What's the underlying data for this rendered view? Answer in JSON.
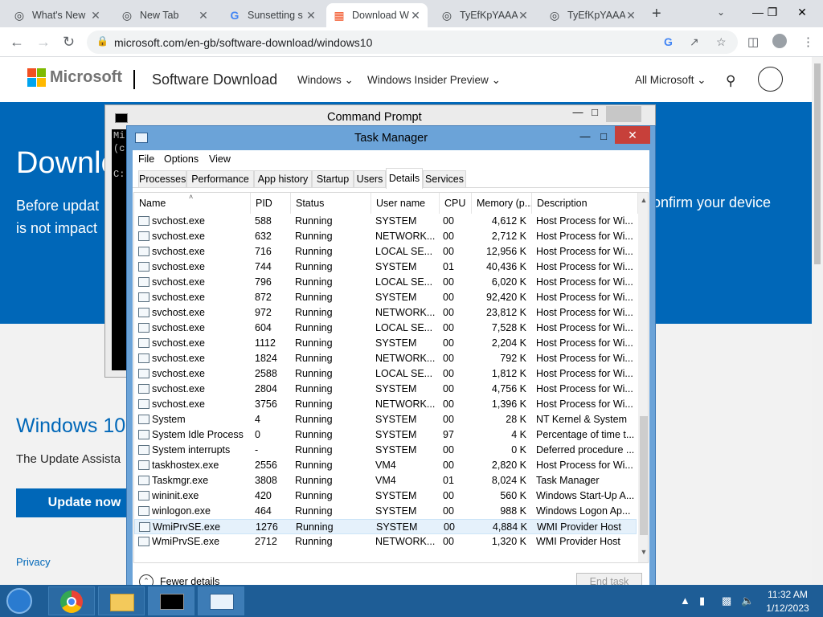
{
  "browser": {
    "tabs": [
      {
        "label": "What's New",
        "icon": "chrome-icon",
        "active": false
      },
      {
        "label": "New Tab",
        "icon": "chrome-icon",
        "active": false
      },
      {
        "label": "Sunsetting s",
        "icon": "google-icon",
        "active": false
      },
      {
        "label": "Download W",
        "icon": "microsoft-icon",
        "active": true
      },
      {
        "label": "TyEfKpYAAA",
        "icon": "chrome-icon",
        "active": false
      },
      {
        "label": "TyEfKpYAAA",
        "icon": "chrome-icon",
        "active": false
      }
    ],
    "url": "microsoft.com/en-gb/software-download/windows10"
  },
  "mspage": {
    "brand": "Microsoft",
    "title": "Software Download",
    "nav": [
      "Windows",
      "Windows Insider Preview"
    ],
    "all_microsoft": "All Microsoft",
    "hero_title": "Downlo",
    "hero_text_1": "Before updat",
    "hero_text_2": "is not impact",
    "hero_right": "onfirm your device",
    "win10_heading": "Windows 10",
    "update_text": "The Update Assista",
    "update_button": "Update now",
    "privacy": "Privacy"
  },
  "cmd": {
    "title": "Command Prompt",
    "lines": [
      "Mi",
      "(c",
      "",
      "C:"
    ]
  },
  "taskmgr": {
    "title": "Task Manager",
    "menu": [
      "File",
      "Options",
      "View"
    ],
    "tabs": [
      "Processes",
      "Performance",
      "App history",
      "Startup",
      "Users",
      "Details",
      "Services"
    ],
    "active_tab": "Details",
    "columns": [
      "Name",
      "PID",
      "Status",
      "User name",
      "CPU",
      "Memory (p...",
      "Description"
    ],
    "rows": [
      {
        "name": "svchost.exe",
        "pid": "588",
        "status": "Running",
        "user": "SYSTEM",
        "cpu": "00",
        "mem": "4,612 K",
        "desc": "Host Process for Wi..."
      },
      {
        "name": "svchost.exe",
        "pid": "632",
        "status": "Running",
        "user": "NETWORK...",
        "cpu": "00",
        "mem": "2,712 K",
        "desc": "Host Process for Wi..."
      },
      {
        "name": "svchost.exe",
        "pid": "716",
        "status": "Running",
        "user": "LOCAL SE...",
        "cpu": "00",
        "mem": "12,956 K",
        "desc": "Host Process for Wi..."
      },
      {
        "name": "svchost.exe",
        "pid": "744",
        "status": "Running",
        "user": "SYSTEM",
        "cpu": "01",
        "mem": "40,436 K",
        "desc": "Host Process for Wi..."
      },
      {
        "name": "svchost.exe",
        "pid": "796",
        "status": "Running",
        "user": "LOCAL SE...",
        "cpu": "00",
        "mem": "6,020 K",
        "desc": "Host Process for Wi..."
      },
      {
        "name": "svchost.exe",
        "pid": "872",
        "status": "Running",
        "user": "SYSTEM",
        "cpu": "00",
        "mem": "92,420 K",
        "desc": "Host Process for Wi..."
      },
      {
        "name": "svchost.exe",
        "pid": "972",
        "status": "Running",
        "user": "NETWORK...",
        "cpu": "00",
        "mem": "23,812 K",
        "desc": "Host Process for Wi..."
      },
      {
        "name": "svchost.exe",
        "pid": "604",
        "status": "Running",
        "user": "LOCAL SE...",
        "cpu": "00",
        "mem": "7,528 K",
        "desc": "Host Process for Wi..."
      },
      {
        "name": "svchost.exe",
        "pid": "1112",
        "status": "Running",
        "user": "SYSTEM",
        "cpu": "00",
        "mem": "2,204 K",
        "desc": "Host Process for Wi..."
      },
      {
        "name": "svchost.exe",
        "pid": "1824",
        "status": "Running",
        "user": "NETWORK...",
        "cpu": "00",
        "mem": "792 K",
        "desc": "Host Process for Wi..."
      },
      {
        "name": "svchost.exe",
        "pid": "2588",
        "status": "Running",
        "user": "LOCAL SE...",
        "cpu": "00",
        "mem": "1,812 K",
        "desc": "Host Process for Wi..."
      },
      {
        "name": "svchost.exe",
        "pid": "2804",
        "status": "Running",
        "user": "SYSTEM",
        "cpu": "00",
        "mem": "4,756 K",
        "desc": "Host Process for Wi..."
      },
      {
        "name": "svchost.exe",
        "pid": "3756",
        "status": "Running",
        "user": "NETWORK...",
        "cpu": "00",
        "mem": "1,396 K",
        "desc": "Host Process for Wi..."
      },
      {
        "name": "System",
        "pid": "4",
        "status": "Running",
        "user": "SYSTEM",
        "cpu": "00",
        "mem": "28 K",
        "desc": "NT Kernel & System"
      },
      {
        "name": "System Idle Process",
        "pid": "0",
        "status": "Running",
        "user": "SYSTEM",
        "cpu": "97",
        "mem": "4 K",
        "desc": "Percentage of time t..."
      },
      {
        "name": "System interrupts",
        "pid": "-",
        "status": "Running",
        "user": "SYSTEM",
        "cpu": "00",
        "mem": "0 K",
        "desc": "Deferred procedure ..."
      },
      {
        "name": "taskhostex.exe",
        "pid": "2556",
        "status": "Running",
        "user": "VM4",
        "cpu": "00",
        "mem": "2,820 K",
        "desc": "Host Process for Wi..."
      },
      {
        "name": "Taskmgr.exe",
        "pid": "3808",
        "status": "Running",
        "user": "VM4",
        "cpu": "01",
        "mem": "8,024 K",
        "desc": "Task Manager"
      },
      {
        "name": "wininit.exe",
        "pid": "420",
        "status": "Running",
        "user": "SYSTEM",
        "cpu": "00",
        "mem": "560 K",
        "desc": "Windows Start-Up A..."
      },
      {
        "name": "winlogon.exe",
        "pid": "464",
        "status": "Running",
        "user": "SYSTEM",
        "cpu": "00",
        "mem": "988 K",
        "desc": "Windows Logon Ap..."
      },
      {
        "name": "WmiPrvSE.exe",
        "pid": "1276",
        "status": "Running",
        "user": "SYSTEM",
        "cpu": "00",
        "mem": "4,884 K",
        "desc": "WMI Provider Host",
        "selected": true
      },
      {
        "name": "WmiPrvSE.exe",
        "pid": "2712",
        "status": "Running",
        "user": "NETWORK...",
        "cpu": "00",
        "mem": "1,320 K",
        "desc": "WMI Provider Host"
      }
    ],
    "fewer_details": "Fewer details",
    "end_task": "End task"
  },
  "taskbar": {
    "time": "11:32 AM",
    "date": "1/12/2023"
  }
}
